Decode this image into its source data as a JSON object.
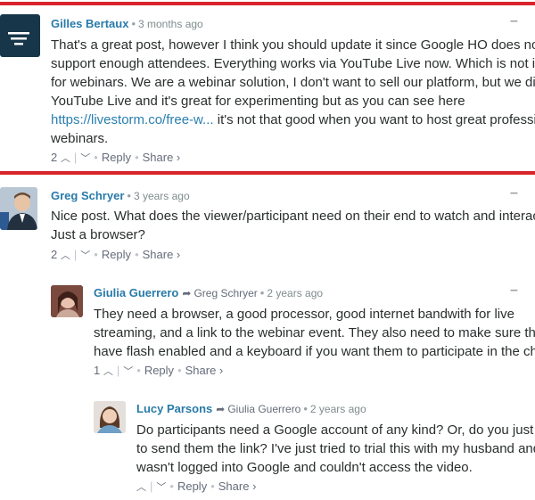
{
  "comments": [
    {
      "author": "Gilles Bertaux",
      "time": "3 months ago",
      "lines": [
        "That's a great post, however I think you should update it since Google HO does not",
        "support enough attendees. Everything works via YouTube Live now. Which is not ide",
        "for webinars. We are a webinar solution, I don't want to sell our platform, but we did t",
        "YouTube Live and it's great for experimenting but as you can see here",
        "it's not that good when you want to host great professio",
        "webinars."
      ],
      "link": "https://livestorm.co/free-w...",
      "upvotes": "2",
      "reply": "Reply",
      "share": "Share ›"
    },
    {
      "author": "Greg Schryer",
      "time": "3 years ago",
      "lines": [
        "Nice post. What does the viewer/participant need on their end to watch and interact?",
        "Just a browser?"
      ],
      "upvotes": "2",
      "reply": "Reply",
      "share": "Share ›"
    },
    {
      "author": "Giulia Guerrero",
      "reply_to": "Greg Schryer",
      "time": "2 years ago",
      "lines": [
        "They need a browser, a good processor, good internet bandwith for live",
        "streaming, and a link to the webinar event. They also need to make sure they",
        "have flash enabled and a keyboard if you want them to participate in the chat"
      ],
      "upvotes": "1",
      "reply": "Reply",
      "share": "Share ›"
    },
    {
      "author": "Lucy Parsons",
      "reply_to": "Giulia Guerrero",
      "time": "2 years ago",
      "lines": [
        "Do participants need a Google account of any kind? Or, do you just h",
        "to send them the link? I've just tried to trial this with my husband and h",
        "wasn't logged into Google and couldn't access the video."
      ],
      "upvotes": "",
      "reply": "Reply",
      "share": "Share ›"
    }
  ],
  "icons": {
    "collapse": "minus-icon",
    "upvote": "chevron-up-icon",
    "downvote": "chevron-down-icon",
    "reply_arrow": "reply-arrow-icon"
  },
  "colors": {
    "highlight_border": "#d8232a",
    "author": "#287aa9",
    "link": "#2a7fb0"
  }
}
